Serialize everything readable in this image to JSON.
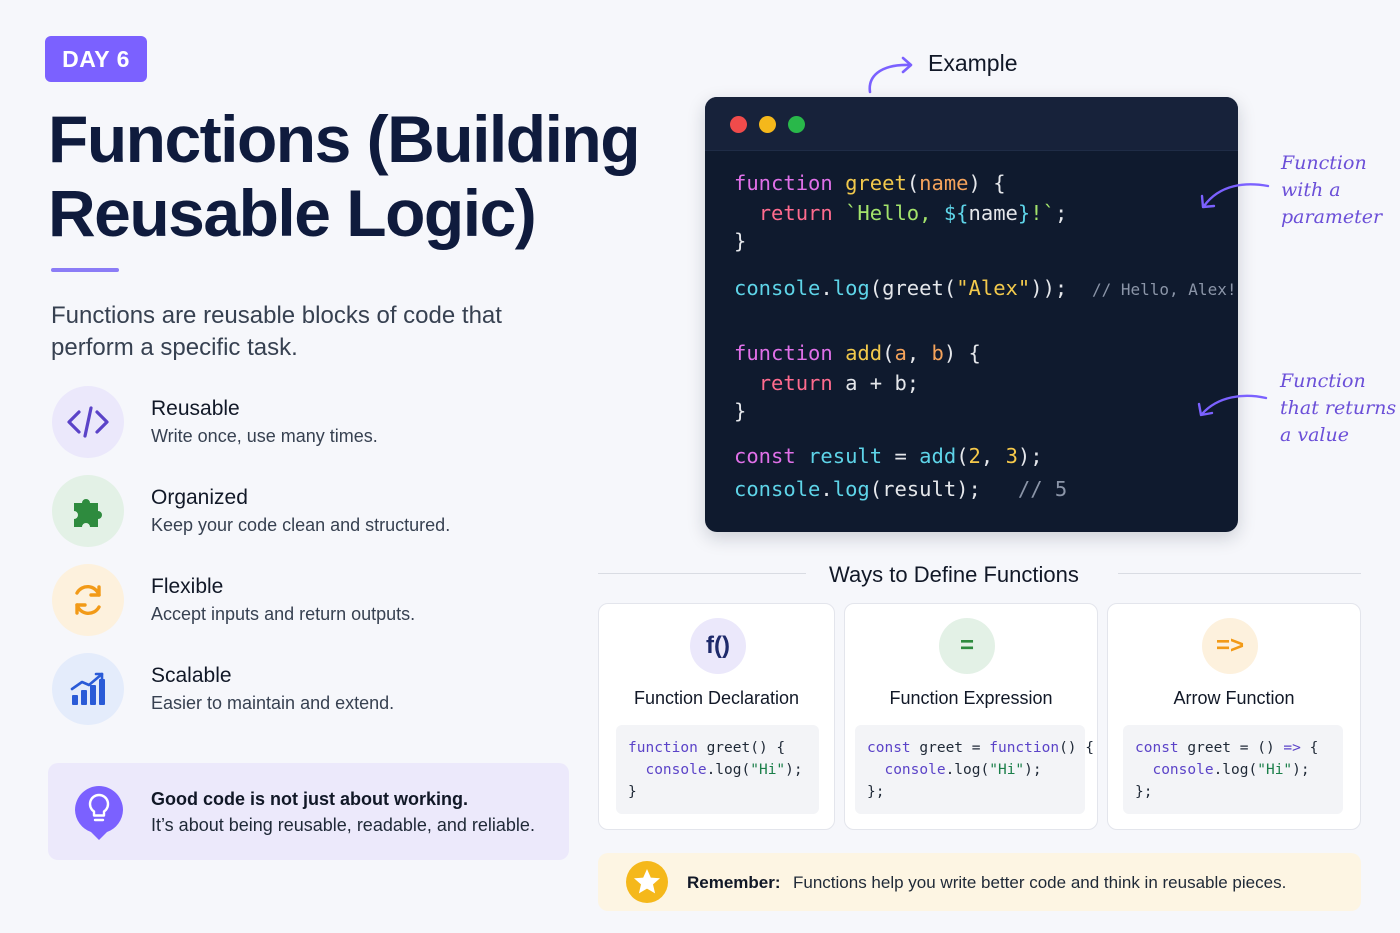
{
  "badge": "DAY 6",
  "title_line1": "Functions (Building",
  "title_line2": "Reusable Logic)",
  "intro": "Functions are reusable blocks of code that perform a specific task.",
  "features": [
    {
      "title": "Reusable",
      "desc": "Write once, use many times.",
      "icon": "code-brackets-icon"
    },
    {
      "title": "Organized",
      "desc": "Keep your code clean and structured.",
      "icon": "puzzle-icon"
    },
    {
      "title": "Flexible",
      "desc": "Accept inputs and return outputs.",
      "icon": "refresh-icon"
    },
    {
      "title": "Scalable",
      "desc": "Easier to maintain and extend.",
      "icon": "chart-growth-icon"
    }
  ],
  "quote": {
    "line1": "Good code is not just about working.",
    "line2": "It’s about being reusable, readable, and reliable."
  },
  "example": {
    "label": "Example",
    "annotation1": [
      "Function",
      "with a",
      "parameter"
    ],
    "annotation2": [
      "Function",
      "that returns",
      "a value"
    ]
  },
  "ways": {
    "title": "Ways to Define Functions",
    "cards": [
      {
        "icon_text": "f()",
        "title": "Function Declaration"
      },
      {
        "icon_text": "=",
        "title": "Function Expression"
      },
      {
        "icon_text": "=>",
        "title": "Arrow Function"
      }
    ]
  },
  "remember": {
    "label": "Remember:",
    "text": "Functions help you write better code and think in reusable pieces."
  },
  "colors": {
    "accent": "#7b61ff",
    "code_bg": "#0f1a2e",
    "remember_bg": "#fdf5e3"
  }
}
